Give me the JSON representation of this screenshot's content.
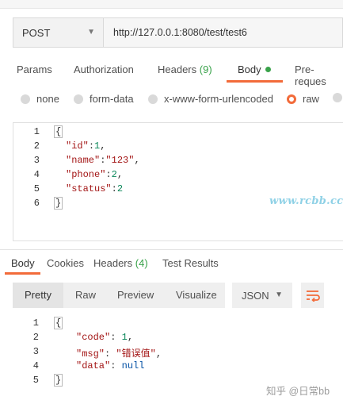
{
  "request": {
    "method": "POST",
    "url": "http://127.0.0.1:8080/test/test6"
  },
  "request_tabs": [
    {
      "label": "Params"
    },
    {
      "label": "Authorization"
    },
    {
      "label": "Headers",
      "count": "(9)"
    },
    {
      "label": "Body"
    },
    {
      "label": "Pre-reques"
    }
  ],
  "body_types": [
    {
      "label": "none",
      "selected": false
    },
    {
      "label": "form-data",
      "selected": false
    },
    {
      "label": "x-www-form-urlencoded",
      "selected": false
    },
    {
      "label": "raw",
      "selected": true
    }
  ],
  "request_body": {
    "line_numbers": [
      "1",
      "2",
      "3",
      "4",
      "5",
      "6"
    ],
    "open_brace": "{",
    "close_brace": "}",
    "lines": [
      {
        "key": "\"id\"",
        "sep": ":",
        "value": "1",
        "end": ","
      },
      {
        "key": "\"name\"",
        "sep": ":",
        "value": "\"123\"",
        "end": ","
      },
      {
        "key": "\"phone\"",
        "sep": ":",
        "value": "2",
        "end": ","
      },
      {
        "key": "\"status\"",
        "sep": ":",
        "value": "2",
        "end": ""
      }
    ]
  },
  "watermark": "www.rcbb.cc",
  "response_tabs": [
    {
      "label": "Body"
    },
    {
      "label": "Cookies"
    },
    {
      "label": "Headers",
      "count": "(4)"
    },
    {
      "label": "Test Results"
    }
  ],
  "response_toolbar": {
    "views": [
      "Pretty",
      "Raw",
      "Preview",
      "Visualize"
    ],
    "format": "JSON"
  },
  "response_body": {
    "line_numbers": [
      "1",
      "2",
      "3",
      "4",
      "5"
    ],
    "open_brace": "{",
    "close_brace": "}",
    "lines": [
      {
        "key": "\"code\"",
        "sep": ": ",
        "value": "1",
        "end": ","
      },
      {
        "key": "\"msg\"",
        "sep": ": ",
        "value": "\"错误值\"",
        "end": ","
      },
      {
        "key": "\"data\"",
        "sep": ": ",
        "value": "null",
        "end": ""
      }
    ]
  },
  "footer_watermark": "知乎 @日常bb",
  "colors": {
    "accent": "#f26b3a",
    "count_green": "#39a24a",
    "json_key": "#a31515",
    "json_number": "#098658",
    "json_null": "#0451a5"
  }
}
